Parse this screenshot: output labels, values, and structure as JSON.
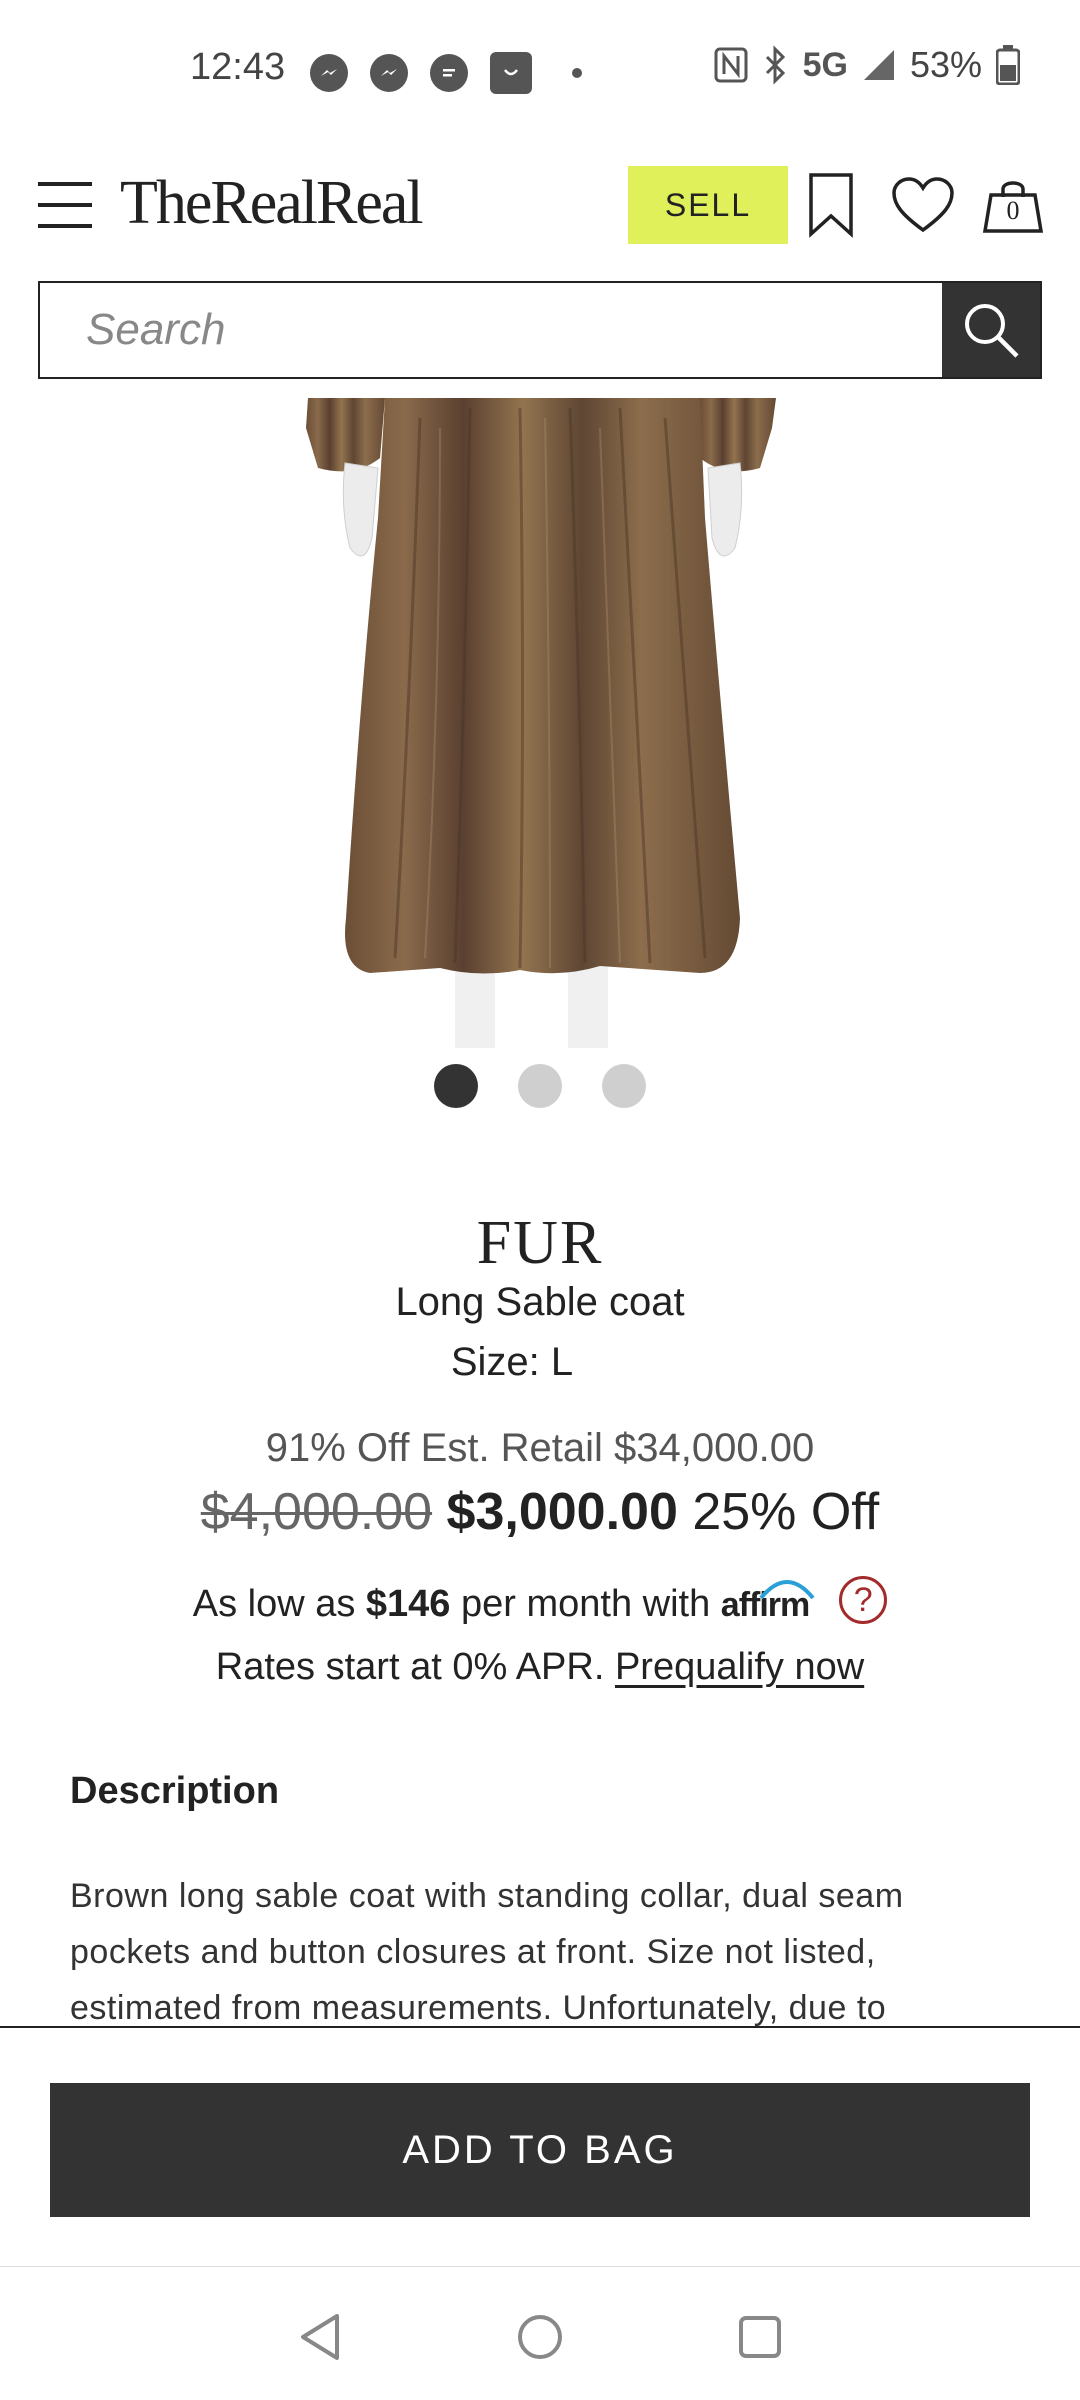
{
  "status_bar": {
    "time": "12:43",
    "network": "5G",
    "battery": "53%",
    "notification_icons": [
      "messenger-icon",
      "messenger-icon",
      "chat-icon",
      "shopping-icon"
    ]
  },
  "header": {
    "logo": "TheRealReal",
    "sell_label": "SELL",
    "bag_count": "0"
  },
  "search": {
    "placeholder": "Search",
    "value": ""
  },
  "gallery": {
    "slide_count": 3,
    "active_slide": 1
  },
  "product": {
    "brand": "FUR",
    "name": "Long Sable coat",
    "size": "Size: L",
    "est_retail": "91% Off Est. Retail $34,000.00",
    "original_price": "$4,000.00",
    "price": "$3,000.00",
    "discount": "25% Off"
  },
  "financing": {
    "prefix": "As low as ",
    "amount": "$146",
    "suffix": " per month with ",
    "provider": "affirm",
    "rates_text": "Rates start at 0% APR. ",
    "prequalify_label": "Prequalify now"
  },
  "description": {
    "title": "Description",
    "body": "Brown long sable coat with standing collar, dual seam pockets and button closures at front. Size not listed, estimated from measurements. Unfortunately, due to"
  },
  "actions": {
    "add_to_bag": "ADD TO BAG"
  },
  "colors": {
    "sell_bg": "#dff05b",
    "dark": "#333333",
    "help_red": "#a32b2b",
    "affirm_blue": "#2aa0d8"
  }
}
